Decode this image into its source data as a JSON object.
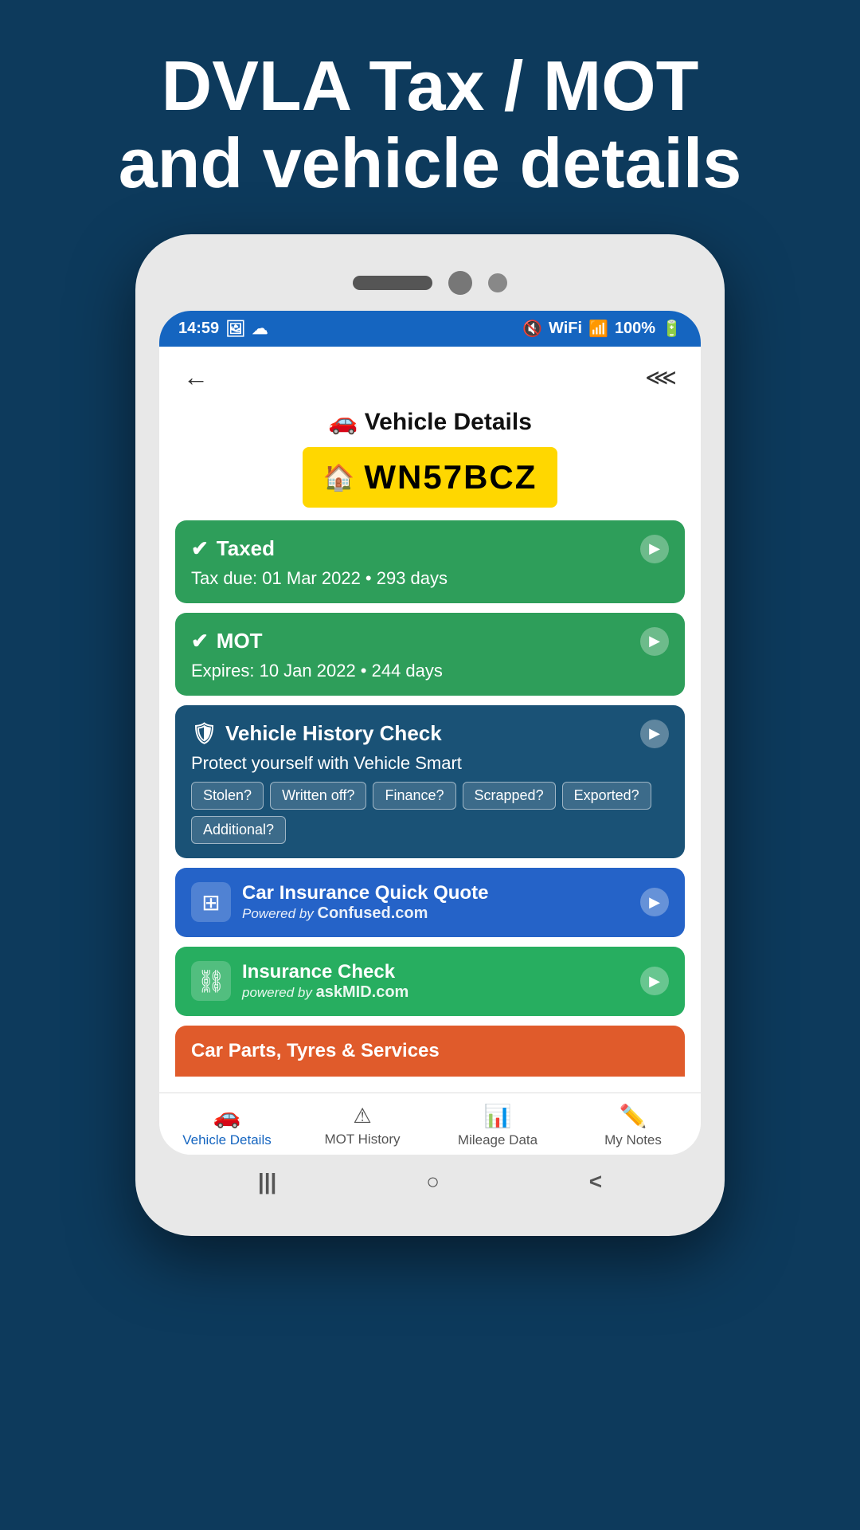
{
  "header": {
    "title_line1": "DVLA Tax / MOT",
    "title_line2": "and vehicle details"
  },
  "status_bar": {
    "time": "14:59",
    "battery": "100%"
  },
  "app_bar": {
    "back_label": "←",
    "share_label": "⋖"
  },
  "vehicle": {
    "title": "🚗 Vehicle Details",
    "plate": "WN57BCZ"
  },
  "tax_card": {
    "icon": "✔",
    "title": "Taxed",
    "subtitle": "Tax due: 01 Mar 2022 • 293 days"
  },
  "mot_card": {
    "icon": "✔",
    "title": "MOT",
    "subtitle": "Expires: 10 Jan 2022 • 244 days"
  },
  "history_card": {
    "title": "Vehicle History Check",
    "subtitle": "Protect yourself with Vehicle Smart",
    "badges": [
      "Stolen?",
      "Written off?",
      "Finance?",
      "Scrapped?",
      "Exported?",
      "Additional?"
    ]
  },
  "insurance_quote_card": {
    "icon": "▦",
    "title": "Car Insurance Quick Quote",
    "powered_by": "Powered by",
    "brand": "Confused.com"
  },
  "insurance_check_card": {
    "icon": "🔗",
    "title": "Insurance Check",
    "powered_by": "powered by",
    "brand": "askMID.com"
  },
  "partial_card": {
    "title": "Car Parts, Tyres & Services"
  },
  "bottom_nav": {
    "items": [
      {
        "icon": "🚗",
        "label": "Vehicle Details",
        "active": true
      },
      {
        "icon": "△!",
        "label": "MOT History",
        "active": false
      },
      {
        "icon": "📶",
        "label": "Mileage Data",
        "active": false
      },
      {
        "icon": "✏️",
        "label": "My Notes",
        "active": false
      }
    ]
  },
  "phone_gestures": [
    "|||",
    "○",
    "<"
  ]
}
